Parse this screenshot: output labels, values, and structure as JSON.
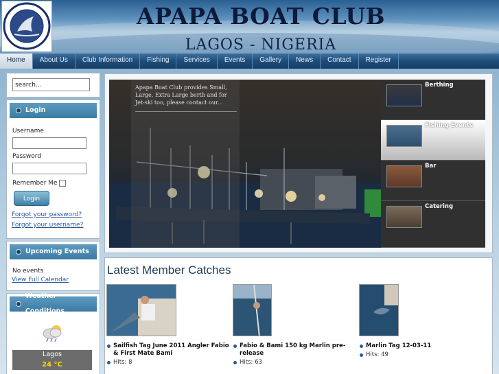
{
  "site": {
    "title": "APAPA BOAT CLUB",
    "subtitle": "LAGOS - NIGERIA",
    "logo_text": "Apapa Boat Club · Lagos Nigeria"
  },
  "nav": {
    "items": [
      {
        "label": "Home",
        "active": true
      },
      {
        "label": "About Us"
      },
      {
        "label": "Club Information"
      },
      {
        "label": "Fishing"
      },
      {
        "label": "Services"
      },
      {
        "label": "Events"
      },
      {
        "label": "Gallery"
      },
      {
        "label": "News"
      },
      {
        "label": "Contact"
      },
      {
        "label": "Register"
      }
    ]
  },
  "search": {
    "placeholder": "search...",
    "value": "search..."
  },
  "login": {
    "heading": "Login",
    "username_label": "Username",
    "password_label": "Password",
    "remember_label": "Remember Me",
    "button_label": "Login",
    "forgot_password": "Forgot your password?",
    "forgot_username": "Forgot your username?"
  },
  "events": {
    "heading": "Upcoming Events",
    "empty_text": "No events",
    "calendar_link": "View Full Calendar"
  },
  "weather": {
    "heading": "Weather Conditions",
    "icon": "cloud-rain-icon",
    "city": "Lagos",
    "temperature": "24 °C"
  },
  "slideshow": {
    "caption": "Apapa Boat Club provides Small, Large, Extra Large berth and for Jet-ski too, please contact our...",
    "items": [
      {
        "label": "Berthing",
        "selected": false
      },
      {
        "label": "Fishing Events",
        "selected": true
      },
      {
        "label": "Bar",
        "selected": false
      },
      {
        "label": "Catering",
        "selected": false
      }
    ]
  },
  "catches": {
    "heading": "Latest Member Catches",
    "items": [
      {
        "title": "Sailfish Tag June 2011 Angler Fabio & First Mate Bami",
        "hits": "Hits: 8"
      },
      {
        "title": "Fabio & Bami 150 kg Marlin pre-release",
        "hits": "Hits: 63"
      },
      {
        "title": "Marlin Tag 12-03-11",
        "hits": "Hits: 49"
      }
    ]
  },
  "colors": {
    "nav_bg": "#1f4e7c",
    "module_header": "#4a8ab2",
    "link": "#2a5a9a",
    "temp": "#ffd800"
  }
}
